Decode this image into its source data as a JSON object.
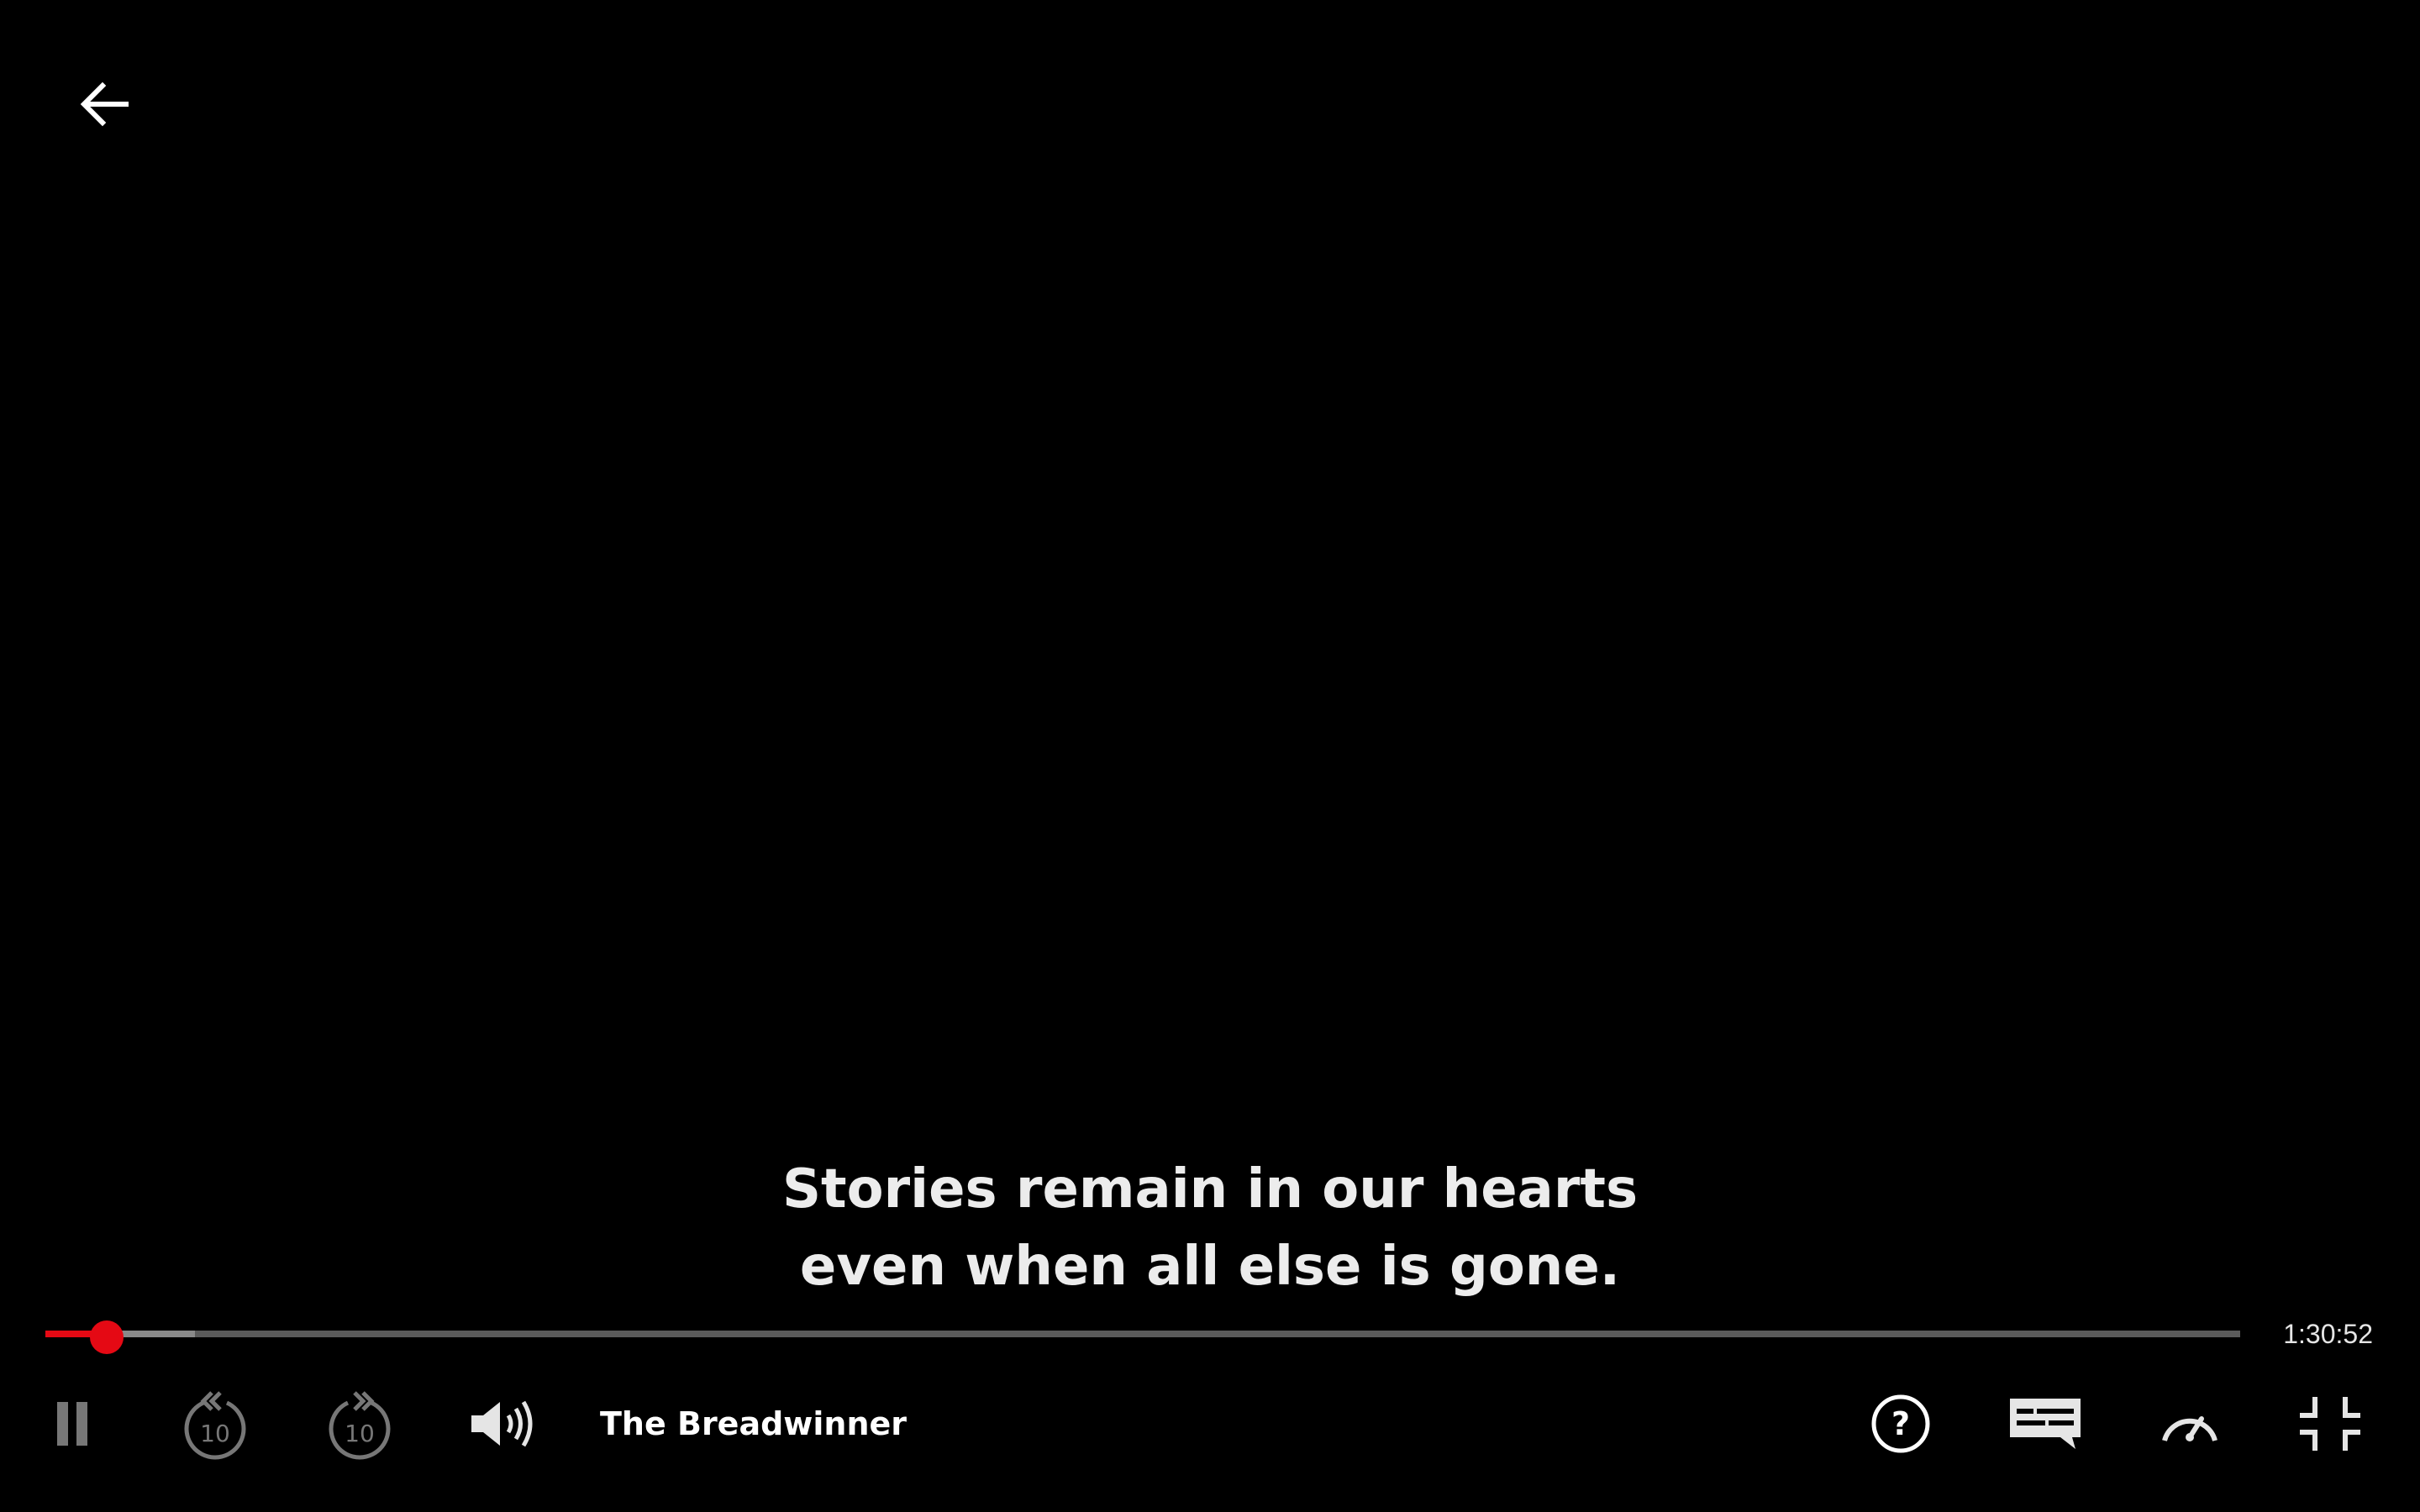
{
  "player": {
    "title": "The Breadwinner",
    "time_remaining": "1:30:52",
    "progress_fraction": 0.028,
    "buffered_fraction": 0.068,
    "accent_color": "#e50914"
  },
  "subtitles": {
    "line1": "Stories remain in our hearts",
    "line2": "even when all else is gone."
  },
  "controls": {
    "back_icon": "arrow-left-icon",
    "play_state_icon": "pause-icon",
    "rewind_seconds": "10",
    "forward_seconds": "10",
    "volume_icon": "volume-high-icon",
    "help_icon": "question-icon",
    "subtitles_icon": "subtitles-icon",
    "speed_icon": "speedometer-icon",
    "fullscreen_icon": "exit-fullscreen-icon"
  }
}
